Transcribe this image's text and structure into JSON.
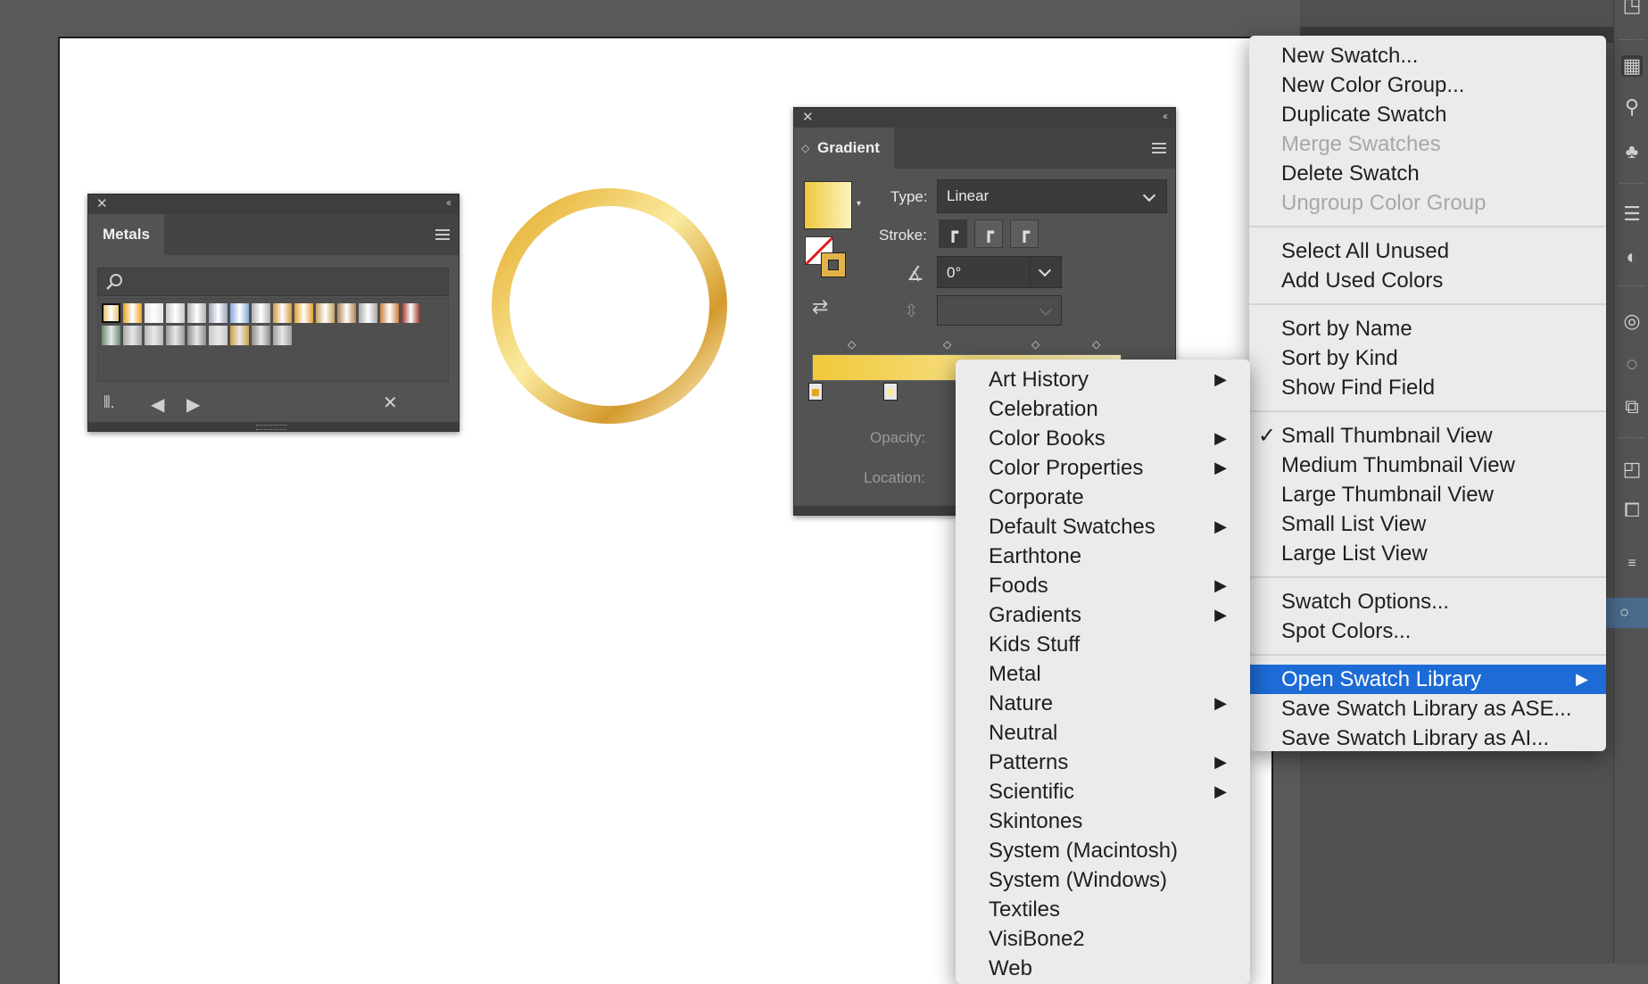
{
  "metals_panel": {
    "tab_label": "Metals",
    "search_placeholder": "",
    "swatch_colors_row1": [
      "#e0b44a",
      "#e8a520",
      "#e4e4e4",
      "#c8c8c8",
      "#b0b0b0",
      "#9aa6b6",
      "#88a8d8",
      "#b0b0b0",
      "#d49840",
      "#e0a030",
      "#c8a060",
      "#b08050",
      "#a8a8a8",
      "#c88040",
      "#903020"
    ],
    "swatch_colors_row2": [
      "#6a8a70",
      "#a8a8a8",
      "#b8b8b8",
      "#9a9a9a",
      "#8c8c8c",
      "#c8c8c8",
      "#d0a040",
      "#8c8c8c",
      "#a0a0a0"
    ]
  },
  "gradient_panel": {
    "tab_label": "Gradient",
    "type_label": "Type:",
    "type_value": "Linear",
    "stroke_label": "Stroke:",
    "angle_value": "0°",
    "opacity_label": "Opacity:",
    "location_label": "Location:",
    "gradient_start_color": "#f0c83a",
    "gradient_end_color": "#fdf3c0"
  },
  "swatches_menu": {
    "items": [
      {
        "label": "New Swatch...",
        "enabled": true
      },
      {
        "label": "New Color Group...",
        "enabled": true
      },
      {
        "label": "Duplicate Swatch",
        "enabled": true
      },
      {
        "label": "Merge Swatches",
        "enabled": false
      },
      {
        "label": "Delete Swatch",
        "enabled": true
      },
      {
        "label": "Ungroup Color Group",
        "enabled": false
      },
      {
        "label": "Select All Unused",
        "enabled": true
      },
      {
        "label": "Add Used Colors",
        "enabled": true
      },
      {
        "label": "Sort by Name",
        "enabled": true
      },
      {
        "label": "Sort by Kind",
        "enabled": true
      },
      {
        "label": "Show Find Field",
        "enabled": true
      },
      {
        "label": "Small Thumbnail View",
        "enabled": true,
        "checked": true
      },
      {
        "label": "Medium Thumbnail View",
        "enabled": true
      },
      {
        "label": "Large Thumbnail View",
        "enabled": true
      },
      {
        "label": "Small List View",
        "enabled": true
      },
      {
        "label": "Large List View",
        "enabled": true
      },
      {
        "label": "Swatch Options...",
        "enabled": true
      },
      {
        "label": "Spot Colors...",
        "enabled": true
      },
      {
        "label": "Open Swatch Library",
        "enabled": true,
        "highlighted": true,
        "submenu": true
      },
      {
        "label": "Save Swatch Library as ASE...",
        "enabled": true
      },
      {
        "label": "Save Swatch Library as AI...",
        "enabled": true
      }
    ],
    "check_glyph": "✓",
    "arrow_glyph": "▶"
  },
  "library_submenu": {
    "items": [
      {
        "label": "Art History",
        "submenu": true
      },
      {
        "label": "Celebration",
        "submenu": false
      },
      {
        "label": "Color Books",
        "submenu": true
      },
      {
        "label": "Color Properties",
        "submenu": true
      },
      {
        "label": "Corporate",
        "submenu": false
      },
      {
        "label": "Default Swatches",
        "submenu": true
      },
      {
        "label": "Earthtone",
        "submenu": false
      },
      {
        "label": "Foods",
        "submenu": true
      },
      {
        "label": "Gradients",
        "submenu": true
      },
      {
        "label": "Kids Stuff",
        "submenu": false
      },
      {
        "label": "Metal",
        "submenu": false
      },
      {
        "label": "Nature",
        "submenu": true
      },
      {
        "label": "Neutral",
        "submenu": false
      },
      {
        "label": "Patterns",
        "submenu": true
      },
      {
        "label": "Scientific",
        "submenu": true
      },
      {
        "label": "Skintones",
        "submenu": false
      },
      {
        "label": "System (Macintosh)",
        "submenu": false
      },
      {
        "label": "System (Windows)",
        "submenu": false
      },
      {
        "label": "Textiles",
        "submenu": false
      },
      {
        "label": "VisiBone2",
        "submenu": false
      },
      {
        "label": "Web",
        "submenu": false
      }
    ]
  },
  "canvas": {
    "ring_colors": [
      "#e3a823",
      "#fbeba0",
      "#d49a2c",
      "#fff6cc"
    ]
  },
  "colors": {
    "menu_highlight": "#1d6bd6",
    "panel_bg": "#535353",
    "app_bg": "#595959"
  }
}
